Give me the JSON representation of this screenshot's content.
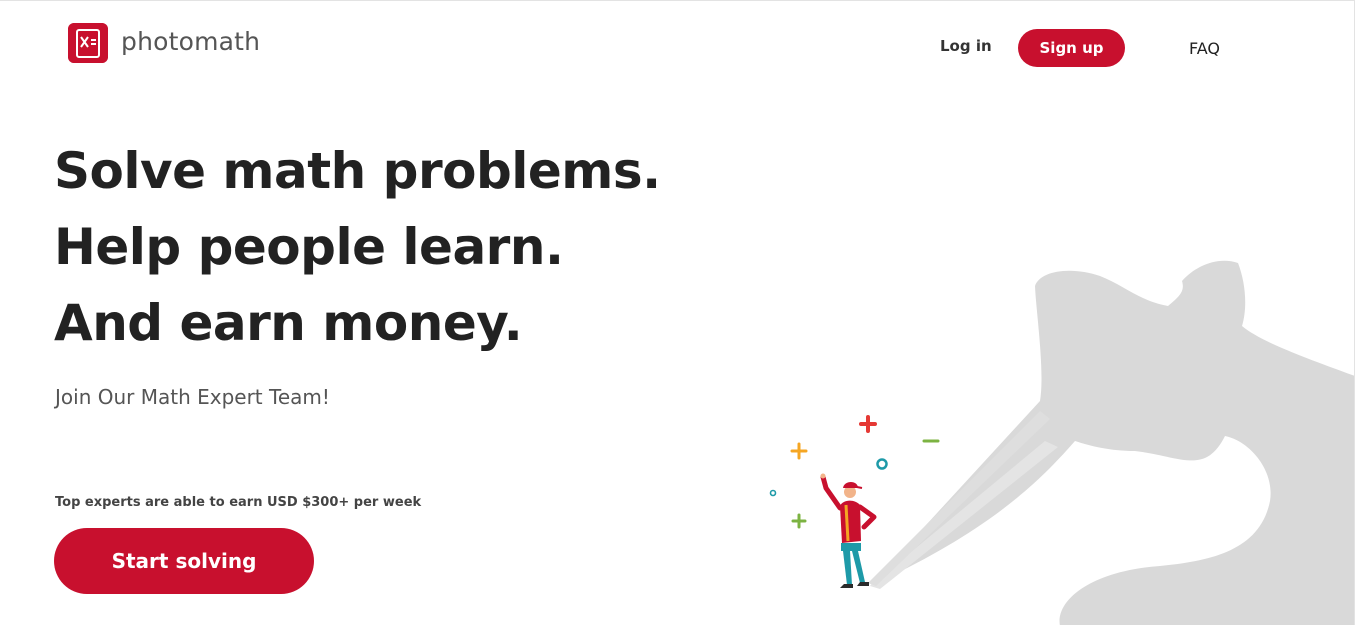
{
  "header": {
    "logo_text": "photomath",
    "logo_icon": "photomath-logo-icon",
    "nav": {
      "login_label": "Log in",
      "signup_label": "Sign up",
      "faq_label": "FAQ"
    }
  },
  "hero": {
    "headline_lines": [
      "Solve math problems.",
      "Help people learn.",
      "And earn money."
    ],
    "subhead": "Join Our Math Expert Team!",
    "earn_note": "Top experts are able to earn USD $300+ per week",
    "cta_label": "Start solving"
  },
  "colors": {
    "brand": "#c8102e",
    "text_dark": "#222222",
    "shadow_gray": "#d9d9d9",
    "symbol_red": "#e53935",
    "symbol_orange": "#f5a623",
    "symbol_green": "#7cb342",
    "symbol_teal": "#1e9aa8",
    "figure_jacket": "#c8102e",
    "figure_pants": "#1e9aa8"
  }
}
